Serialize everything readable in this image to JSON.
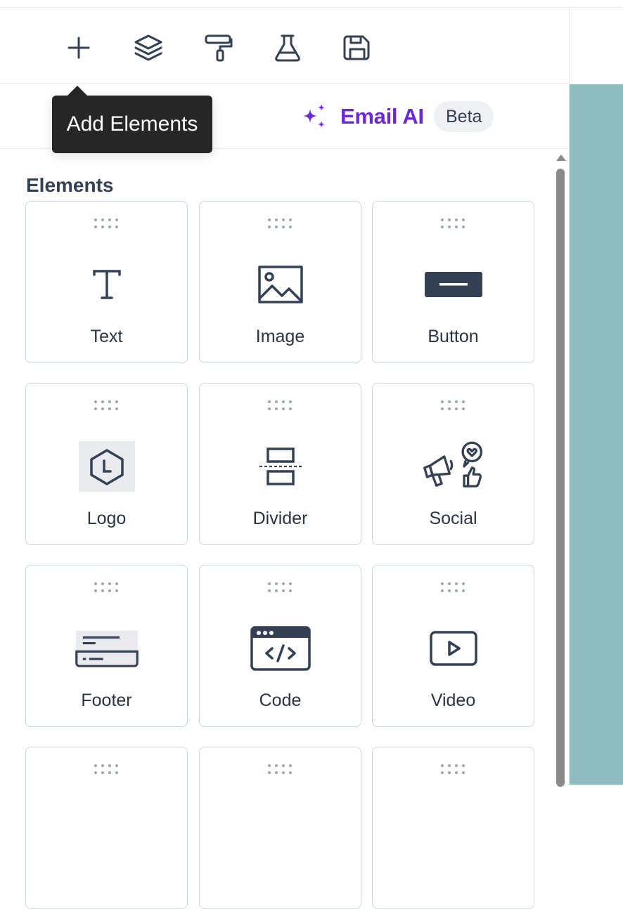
{
  "toolbar": {
    "buttons": [
      {
        "name": "add-elements",
        "icon": "plus-icon"
      },
      {
        "name": "layers",
        "icon": "layers-icon"
      },
      {
        "name": "styles",
        "icon": "paint-roller-icon"
      },
      {
        "name": "test",
        "icon": "flask-icon"
      },
      {
        "name": "save",
        "icon": "save-icon"
      }
    ]
  },
  "tooltip": {
    "text": "Add Elements"
  },
  "subbar": {
    "email_ai_label": "Email AI",
    "email_ai_icon": "sparkles-icon",
    "beta_badge": "Beta"
  },
  "elements_panel": {
    "title": "Elements",
    "items": [
      {
        "label": "Text",
        "icon": "text-icon"
      },
      {
        "label": "Image",
        "icon": "image-icon"
      },
      {
        "label": "Button",
        "icon": "button-icon"
      },
      {
        "label": "Logo",
        "icon": "logo-icon"
      },
      {
        "label": "Divider",
        "icon": "divider-icon"
      },
      {
        "label": "Social",
        "icon": "social-icon"
      },
      {
        "label": "Footer",
        "icon": "footer-icon"
      },
      {
        "label": "Code",
        "icon": "code-icon"
      },
      {
        "label": "Video",
        "icon": "video-icon"
      }
    ]
  },
  "colors": {
    "accent": "#6d28d9",
    "icon": "#344054",
    "tooltip_bg": "#262626",
    "canvas_bg": "#8fbdbf"
  }
}
